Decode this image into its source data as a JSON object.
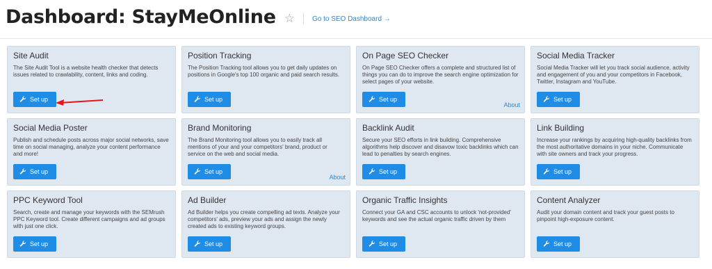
{
  "header": {
    "title": "Dashboard: StayMeOnline",
    "star_icon": "star-icon",
    "seo_link": "Go to SEO Dashboard →"
  },
  "cards": [
    {
      "title": "Site Audit",
      "desc": "The Site Audit Tool is a website health checker that detects issues related to crawlability, content, links and coding.",
      "button": "Set up",
      "about": ""
    },
    {
      "title": "Position Tracking",
      "desc": "The Position Tracking tool allows you to get daily updates on positions in Google's top 100 organic and paid search results.",
      "button": "Set up",
      "about": ""
    },
    {
      "title": "On Page SEO Checker",
      "desc": "On Page SEO Checker offers a complete and structured list of things you can do to improve the search engine optimization for select pages of your website.",
      "button": "Set up",
      "about": "About"
    },
    {
      "title": "Social Media Tracker",
      "desc": "Social Media Tracker will let you track social audience, activity and engagement of you and your competitors in Facebook, Twitter, Instagram and YouTube.",
      "button": "Set up",
      "about": ""
    },
    {
      "title": "Social Media Poster",
      "desc": "Publish and schedule posts across major social networks, save time on social managing, analyze your content performance and more!",
      "button": "Set up",
      "about": ""
    },
    {
      "title": "Brand Monitoring",
      "desc": "The Brand Monitoring tool allows you to easily track all mentions of your and your competitors' brand, product or service on the web and social media.",
      "button": "Set up",
      "about": "About"
    },
    {
      "title": "Backlink Audit",
      "desc": "Secure your SEO efforts in link building. Comprehensive algorithms help discover and disavow toxic backlinks which can lead to penalties by search engines.",
      "button": "Set up",
      "about": ""
    },
    {
      "title": " Link Building",
      "desc": "Increase your rankings by acquiring high-quality backlinks from the most authoritative domains in your niche. Communicate with site owners and track your progress.",
      "button": "Set up",
      "about": ""
    },
    {
      "title": "PPC Keyword Tool",
      "desc": "Search, create and manage your keywords with the SEMrush PPC Keyword tool. Create different campaigns and ad groups with just one click.",
      "button": "Set up",
      "about": ""
    },
    {
      "title": "Ad Builder",
      "desc": "Ad Builder helps you create compelling ad texts. Analyze your competitors' ads, preview your ads and assign the newly created ads to existing keyword groups.",
      "button": "Set up",
      "about": ""
    },
    {
      "title": "Organic Traffic Insights",
      "desc": "Connect your GA and CSC accounts to unlock 'not-provided' keywords and see the actual organic traffic driven by them",
      "button": "Set up",
      "about": ""
    },
    {
      "title": "Content Analyzer",
      "desc": "Audit your domain content and track your guest posts to pinpoint high-exposure content.",
      "button": "Set up",
      "about": ""
    }
  ],
  "colors": {
    "accent": "#1f8ce6",
    "card_bg": "#dfe7f1",
    "link": "#2e86d6",
    "annotation_arrow": "#e8141b"
  }
}
